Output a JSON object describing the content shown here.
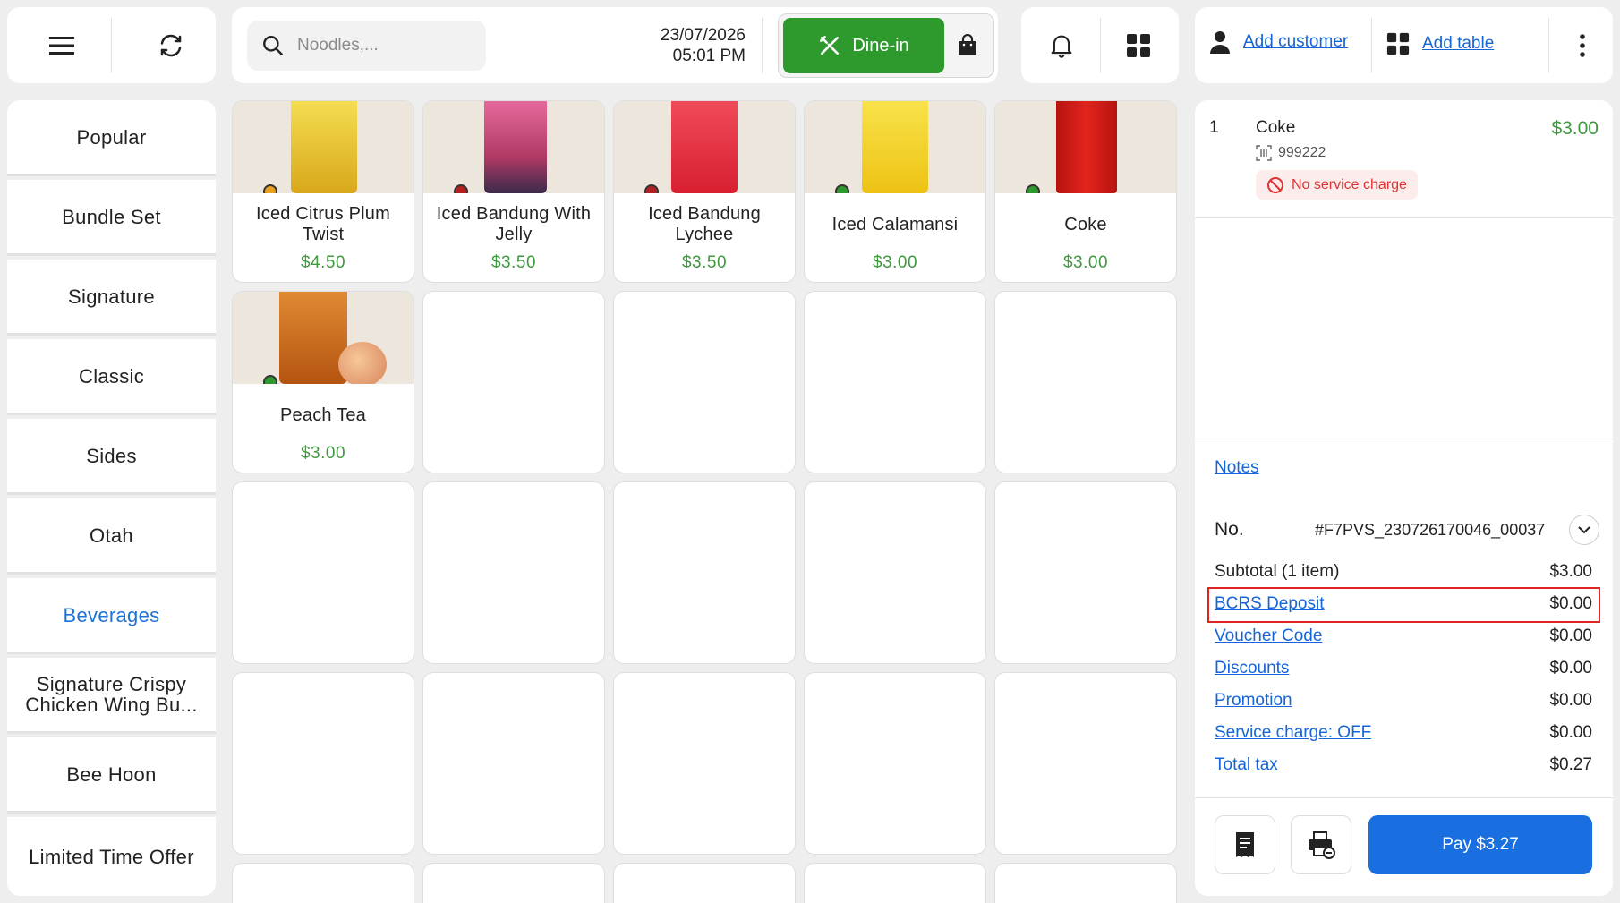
{
  "header": {
    "search_placeholder": "Noodles,...",
    "date": "23/07/2026",
    "time": "05:01 PM",
    "order_type": "Dine-in",
    "add_customer": "Add customer",
    "add_table": "Add table"
  },
  "categories": [
    {
      "label": "Popular",
      "active": false
    },
    {
      "label": "Bundle Set",
      "active": false
    },
    {
      "label": "Signature",
      "active": false
    },
    {
      "label": "Classic",
      "active": false
    },
    {
      "label": "Sides",
      "active": false
    },
    {
      "label": "Otah",
      "active": false
    },
    {
      "label": "Beverages",
      "active": true
    },
    {
      "label": "Signature Crispy Chicken Wing Bu...",
      "active": false
    },
    {
      "label": "Bee Hoon",
      "active": false
    },
    {
      "label": "Limited Time Offer",
      "active": false
    }
  ],
  "products": [
    {
      "name": "Iced Citrus Plum Twist",
      "price": "$4.50",
      "color": "#e8c22a"
    },
    {
      "name": "Iced Bandung With Jelly",
      "price": "$3.50",
      "color": "#d9527e"
    },
    {
      "name": "Iced Bandung Lychee",
      "price": "$3.50",
      "color": "#e8283a"
    },
    {
      "name": "Iced Calamansi",
      "price": "$3.00",
      "color": "#f1d21e"
    },
    {
      "name": "Coke",
      "price": "$3.00",
      "color": "#d8201e"
    },
    {
      "name": "Peach Tea",
      "price": "$3.00",
      "color": "#c96b1c"
    }
  ],
  "cart": {
    "items": [
      {
        "qty": "1",
        "name": "Coke",
        "sku": "999222",
        "price": "$3.00",
        "badge": "No service charge"
      }
    ],
    "notes_label": "Notes",
    "order_no_label": "No.",
    "order_no": "#F7PVS_230726170046_00037",
    "subtotal_label": "Subtotal (1 item)",
    "subtotal": "$3.00",
    "bcrs_label": "BCRS Deposit",
    "bcrs": "$0.00",
    "voucher_label": "Voucher Code",
    "voucher": "$0.00",
    "discounts_label": "Discounts",
    "discounts": "$0.00",
    "promotion_label": "Promotion",
    "promotion": "$0.00",
    "service_label": "Service charge: OFF",
    "service": "$0.00",
    "tax_label": "Total tax",
    "tax": "$0.27",
    "pay_label": "Pay $3.27"
  },
  "colors": {
    "accent_blue": "#1565d8",
    "dinein_green": "#2e9a2e",
    "price_green": "#3f9a3f",
    "highlight_red": "#e02424"
  }
}
